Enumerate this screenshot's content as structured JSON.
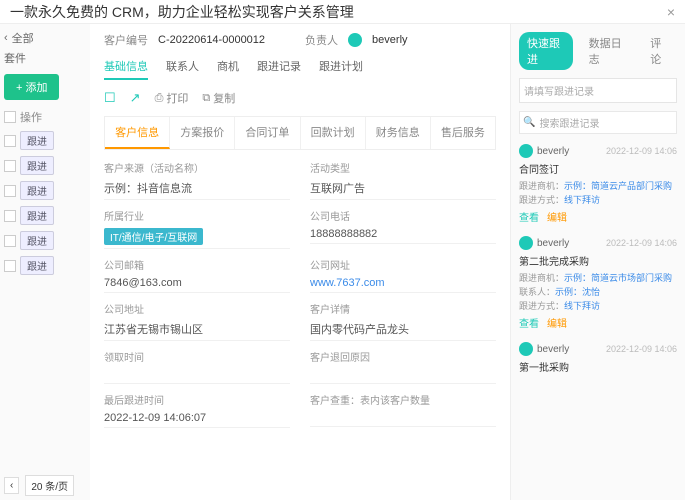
{
  "banner": {
    "text": "一款永久免费的 CRM，助力企业轻松实现客户关系管理",
    "close": "×"
  },
  "bg": {
    "back": "‹",
    "all": "全部",
    "suffix": "套件",
    "add": "+ 添加",
    "action_header": "操作",
    "follow": "跟进",
    "page_prev": "‹",
    "page_size": "20 条/页"
  },
  "header": {
    "id_label": "客户编号",
    "id_value": "C-20220614-0000012",
    "owner_label": "负责人",
    "owner_value": "beverly"
  },
  "tabs": [
    "基础信息",
    "联系人",
    "商机",
    "跟进记录",
    "跟进计划"
  ],
  "toolbar": {
    "open": "☐",
    "share": "↗",
    "print_icon": "⎙",
    "print": "打印",
    "copy_icon": "⧉",
    "copy": "复制"
  },
  "subtabs": [
    "客户信息",
    "方案报价",
    "合同订单",
    "回款计划",
    "财务信息",
    "售后服务"
  ],
  "fields": {
    "source_label": "客户来源（活动名称）",
    "source_value": "示例：抖音信息流",
    "type_label": "活动类型",
    "type_value": "互联网广告",
    "industry_label": "所属行业",
    "industry_value": "IT/通信/电子/互联网",
    "phone_label": "公司电话",
    "phone_value": "18888888882",
    "email_label": "公司邮箱",
    "email_value": "7846@163.com",
    "website_label": "公司网址",
    "website_value": "www.7637.com",
    "address_label": "公司地址",
    "address_value": "江苏省无锡市锡山区",
    "detail_label": "客户详情",
    "detail_value": "国内零代码产品龙头",
    "receive_label": "领取时间",
    "receive_value": "",
    "return_label": "客户退回原因",
    "return_value": "",
    "last_label": "最后跟进时间",
    "last_value": "2022-12-09 14:06:07",
    "dup_label": "客户查重：表内该客户数量",
    "dup_value": ""
  },
  "side": {
    "tabs": [
      "快速跟进",
      "数据日志",
      "评论"
    ],
    "input_placeholder": "请填写跟进记录",
    "search_placeholder": "搜索跟进记录",
    "search_icon": "🔍"
  },
  "feed": [
    {
      "name": "beverly",
      "time": "2022-12-09 14:06",
      "title": "合同签订",
      "rows": [
        {
          "l": "跟进商机：",
          "v": "示例：简道云产品部门采购"
        },
        {
          "l": "跟进方式：",
          "v": "线下拜访"
        }
      ],
      "view": "查看",
      "edit": "编辑"
    },
    {
      "name": "beverly",
      "time": "2022-12-09 14:06",
      "title": "第二批完成采购",
      "rows": [
        {
          "l": "跟进商机：",
          "v": "示例：简道云市场部门采购"
        },
        {
          "l": "联系人：",
          "v": "示例：沈怡"
        },
        {
          "l": "跟进方式：",
          "v": "线下拜访"
        }
      ],
      "view": "查看",
      "edit": "编辑"
    },
    {
      "name": "beverly",
      "time": "2022-12-09 14:06",
      "title": "第一批采购",
      "rows": [],
      "view": "",
      "edit": ""
    }
  ]
}
